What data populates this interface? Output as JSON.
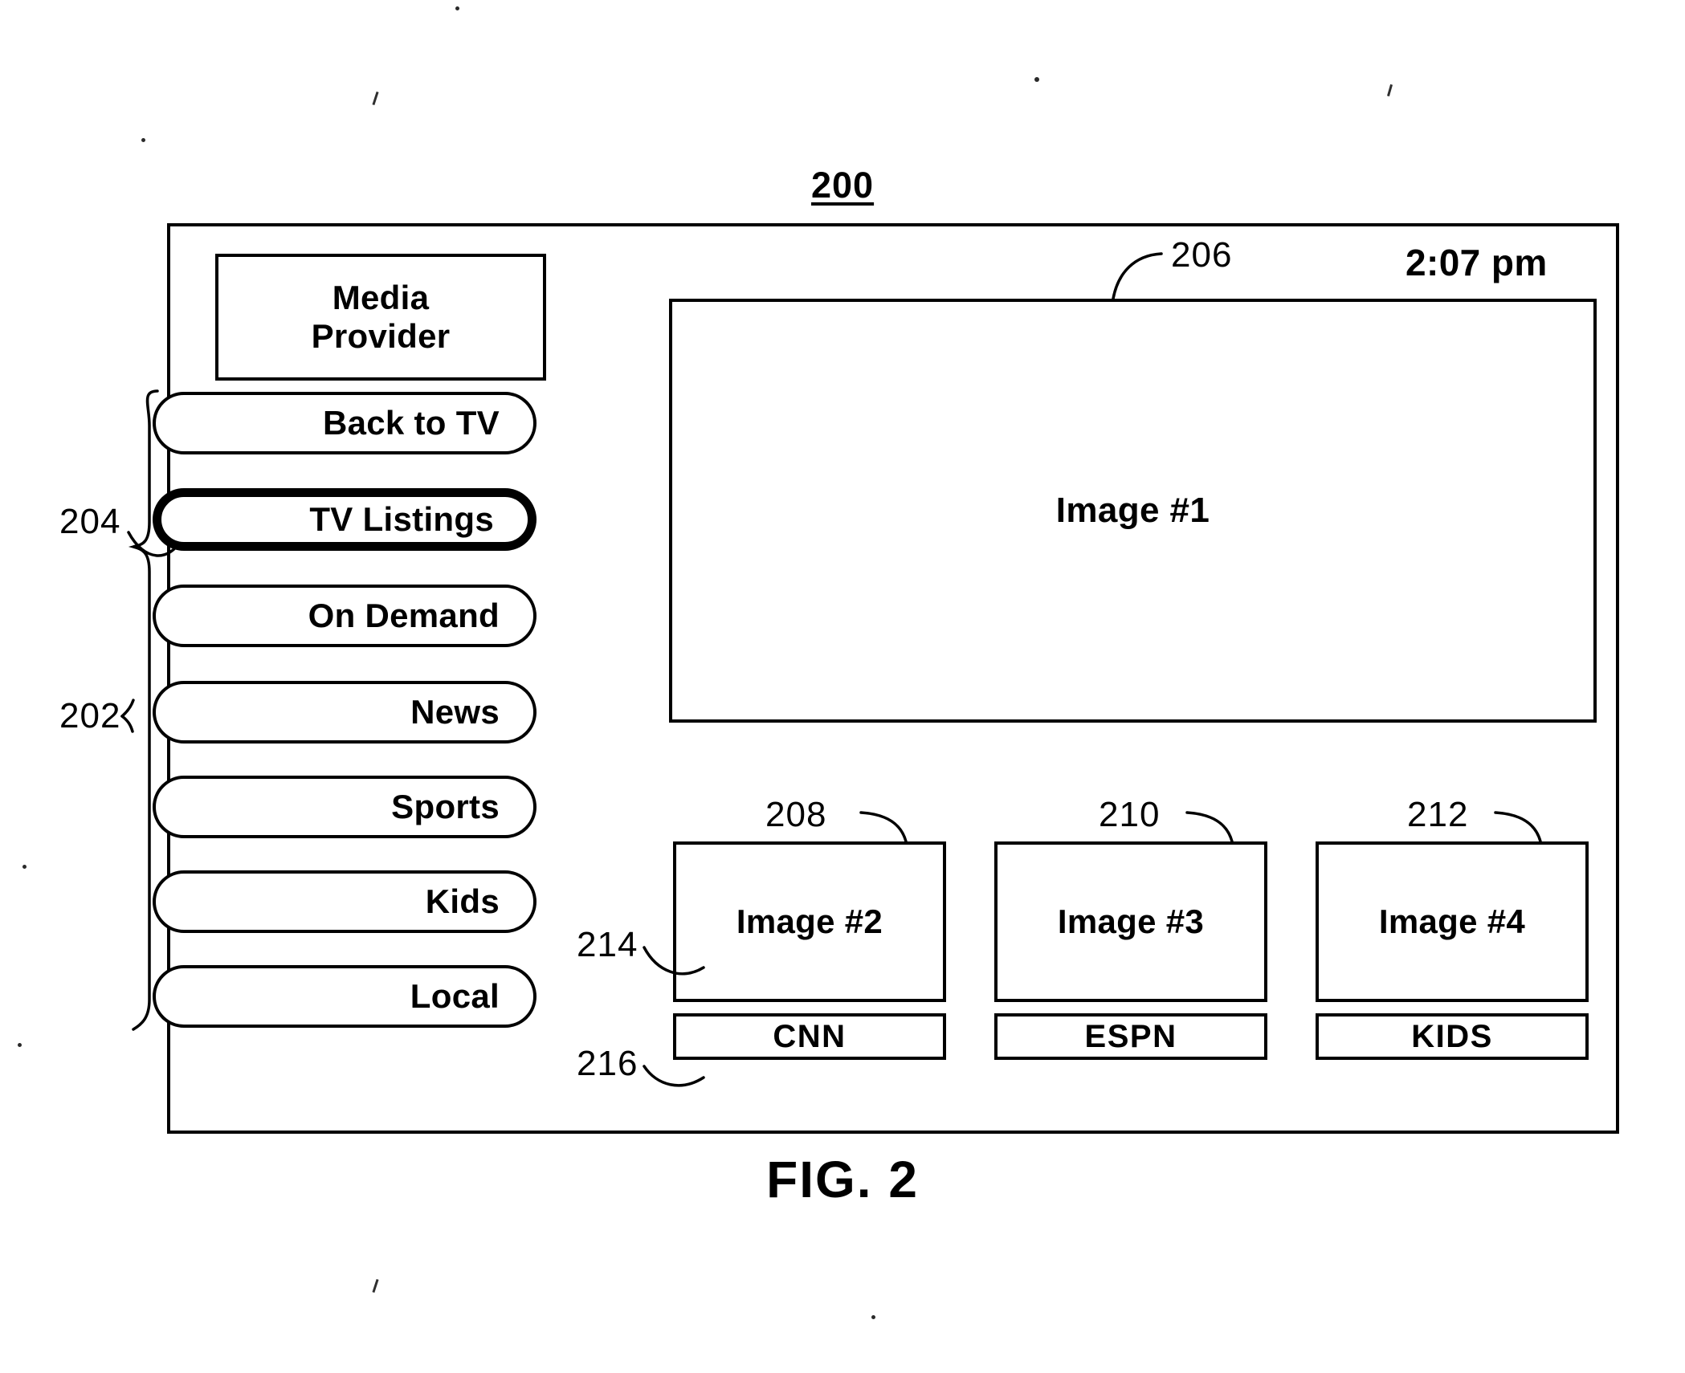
{
  "figure": {
    "caption": "FIG. 2",
    "overall_ref": "200"
  },
  "screen": {
    "clock": "2:07 pm",
    "provider": {
      "line1": "Media",
      "line2": "Provider"
    },
    "menu": {
      "group_ref": "202",
      "selected_ref": "204",
      "items": [
        {
          "label": "Back to TV",
          "selected": false
        },
        {
          "label": "TV Listings",
          "selected": true
        },
        {
          "label": "On Demand",
          "selected": false
        },
        {
          "label": "News",
          "selected": false
        },
        {
          "label": "Sports",
          "selected": false
        },
        {
          "label": "Kids",
          "selected": false
        },
        {
          "label": "Local",
          "selected": false
        }
      ]
    },
    "main_image": {
      "ref": "206",
      "label": "Image #1"
    },
    "thumbnail_ref_214": "214",
    "channel_label_ref_216": "216",
    "thumbnails": [
      {
        "ref": "208",
        "image_label": "Image #2",
        "channel": "CNN"
      },
      {
        "ref": "210",
        "image_label": "Image #3",
        "channel": "ESPN"
      },
      {
        "ref": "212",
        "image_label": "Image #4",
        "channel": "KIDS"
      }
    ]
  },
  "colors": {
    "ink": "#000000",
    "paper": "#ffffff"
  }
}
